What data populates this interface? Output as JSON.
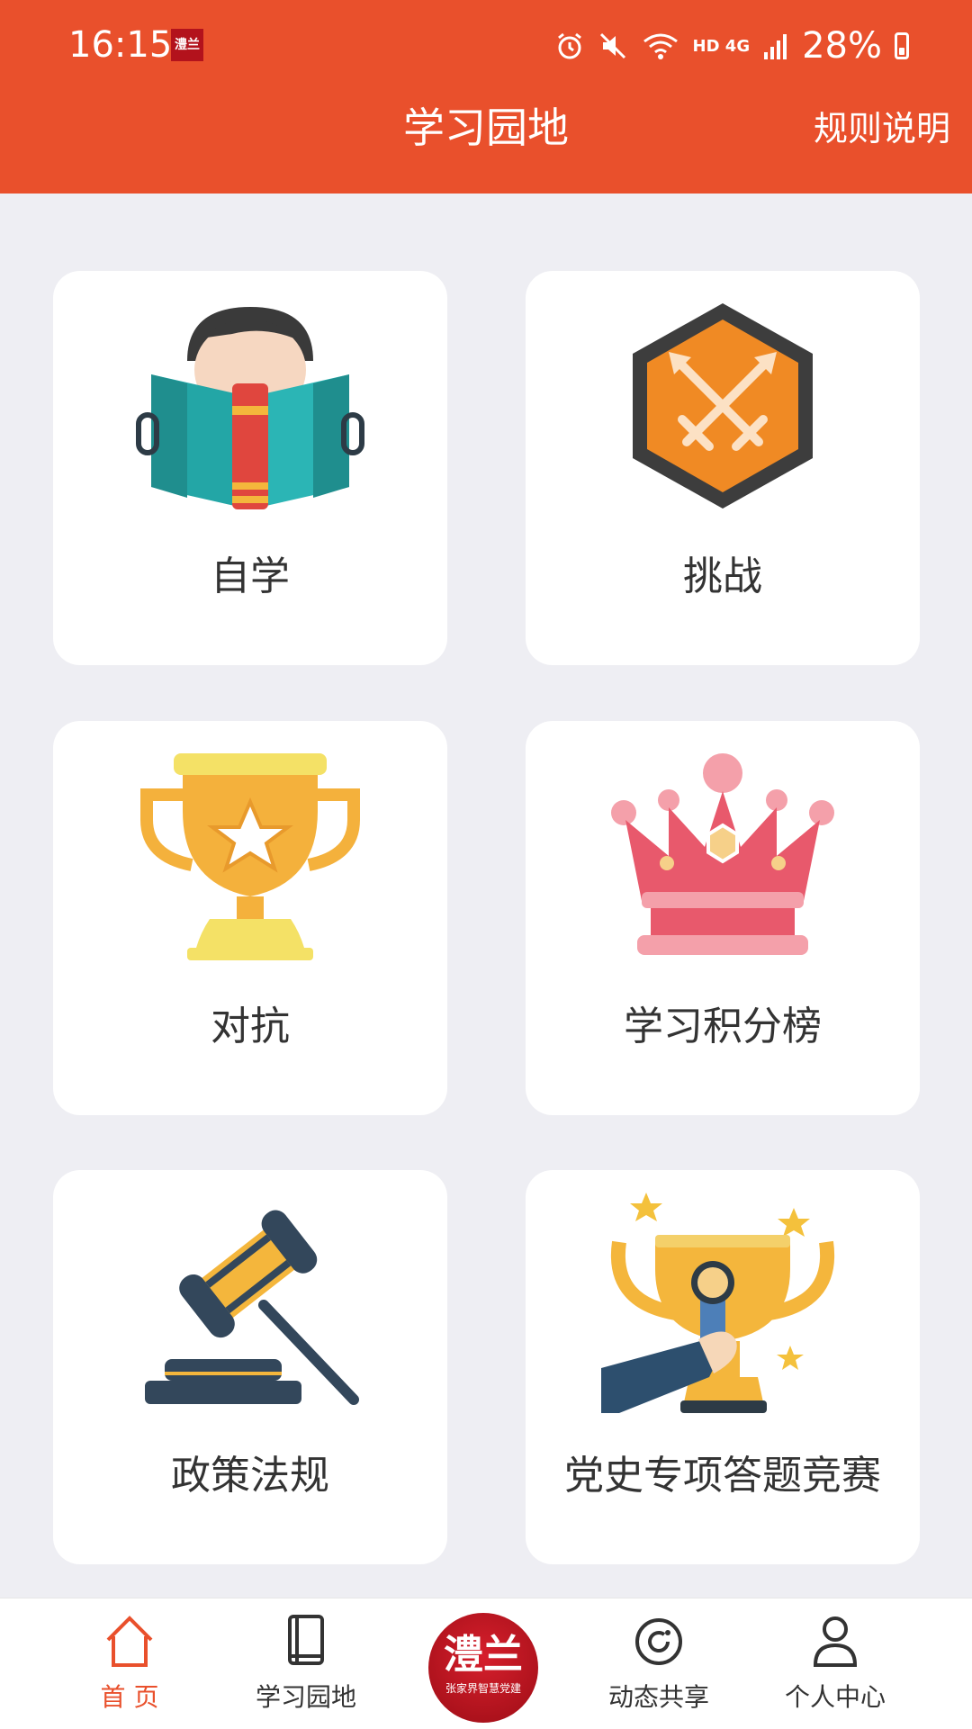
{
  "status_bar": {
    "time": "16:15",
    "app_badge": "澧兰",
    "network": "HD 4G",
    "battery": "28%",
    "icons": [
      "alarm-icon",
      "mute-icon",
      "wifi-icon",
      "signal-icon",
      "battery-icon"
    ]
  },
  "header": {
    "title": "学习园地",
    "rules_label": "规则说明",
    "bg_color": "#e9502c"
  },
  "grid": [
    {
      "label": "自学",
      "icon": "reading-book-icon"
    },
    {
      "label": "挑战",
      "icon": "crossed-swords-badge-icon"
    },
    {
      "label": "对抗",
      "icon": "trophy-star-icon"
    },
    {
      "label": "学习积分榜",
      "icon": "crown-icon"
    },
    {
      "label": "政策法规",
      "icon": "gavel-icon"
    },
    {
      "label": "党史专项答题竞赛",
      "icon": "hand-trophy-medal-icon"
    }
  ],
  "tabbar": {
    "tabs": [
      {
        "label": "首 页",
        "icon": "home-icon",
        "active": true
      },
      {
        "label": "学习园地",
        "icon": "book-icon",
        "active": false
      },
      {
        "label": "",
        "icon": "center-logo",
        "active": false
      },
      {
        "label": "动态共享",
        "icon": "share-icon",
        "active": false
      },
      {
        "label": "个人中心",
        "icon": "person-icon",
        "active": false
      }
    ],
    "center_logo_title": "澧兰",
    "center_logo_subtitle": "张家界智慧党建",
    "active_color": "#e9502c"
  }
}
